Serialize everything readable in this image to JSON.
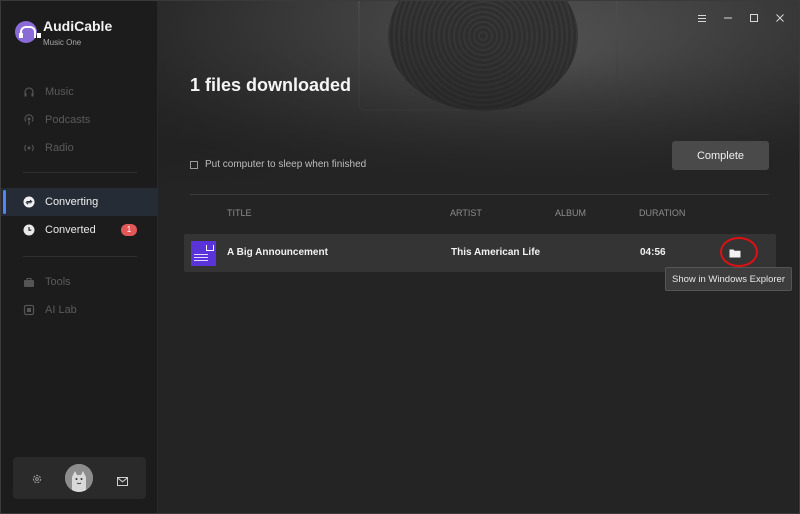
{
  "app": {
    "name": "AudiCable",
    "subtitle": "Music One"
  },
  "sidebar": {
    "items": [
      {
        "label": "Music",
        "icon": "headphones-icon"
      },
      {
        "label": "Podcasts",
        "icon": "podcast-icon"
      },
      {
        "label": "Radio",
        "icon": "radio-icon"
      },
      {
        "label": "Converting",
        "icon": "converting-icon"
      },
      {
        "label": "Converted",
        "icon": "clock-icon",
        "badge": "1"
      },
      {
        "label": "Tools",
        "icon": "toolbox-icon"
      },
      {
        "label": "AI Lab",
        "icon": "ai-icon"
      }
    ]
  },
  "main": {
    "title": "1 files downloaded",
    "sleep_label": "Put computer to sleep when finished",
    "complete_label": "Complete",
    "columns": {
      "title": "TITLE",
      "artist": "ARTIST",
      "album": "ALBUM",
      "duration": "DURATION"
    },
    "rows": [
      {
        "title": "A Big Announcement",
        "artist": "This American Life",
        "album": "",
        "duration": "04:56"
      }
    ],
    "tooltip": "Show in Windows Explorer"
  },
  "colors": {
    "accent": "#4f86f7",
    "badge": "#e25858",
    "highlight_ring": "#dd1111",
    "art": "#5a34d8"
  }
}
